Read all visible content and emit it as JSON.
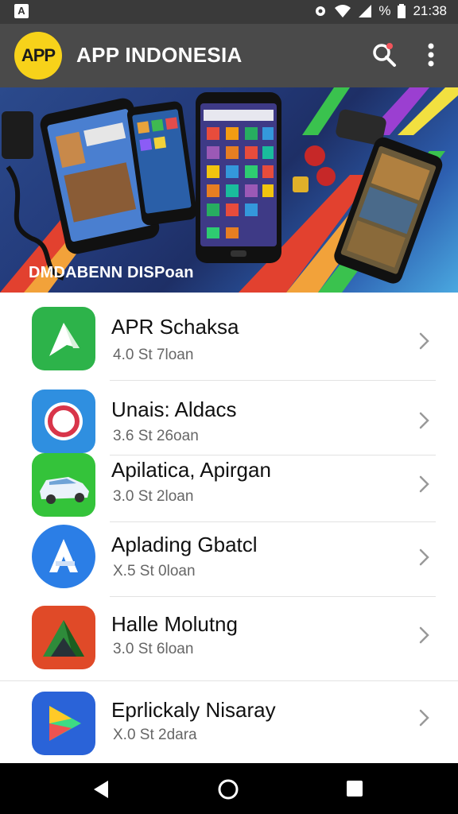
{
  "status_bar": {
    "notification_icon": "A",
    "battery_text": "%",
    "time": "21:38"
  },
  "app_bar": {
    "logo_text": "APP",
    "title": "APP INDONESIA"
  },
  "banner": {
    "caption": "DMDABENN DISPoan"
  },
  "apps": [
    {
      "name": "APR Schaksa",
      "meta": "4.0 St 7loan",
      "icon": "green-arrow-icon",
      "color": "#2db34a"
    },
    {
      "name": "Unais: Aldacs",
      "meta": "3.6 St 26oan",
      "icon": "pink-ring-icon",
      "color": "#2f8fe0"
    },
    {
      "name": "Apilatica, Apirgan",
      "meta": "3.0 St 2loan",
      "icon": "car-icon",
      "color": "#34c33a"
    },
    {
      "name": "Aplading Gbatcl",
      "meta": "X.5 St 0loan",
      "icon": "letter-a-icon",
      "color": "#2b7ee6"
    },
    {
      "name": "Halle Molutng",
      "meta": "3.0 St 6loan",
      "icon": "triangle-icon",
      "color": "#e04a28"
    },
    {
      "name": "Eprlickaly Nisaray",
      "meta": "X.0 St 2dara",
      "icon": "play-icon",
      "color": "#2a63d8"
    }
  ],
  "nav_bar": {
    "back": "back-icon",
    "home": "home-icon",
    "recents": "recents-icon"
  }
}
